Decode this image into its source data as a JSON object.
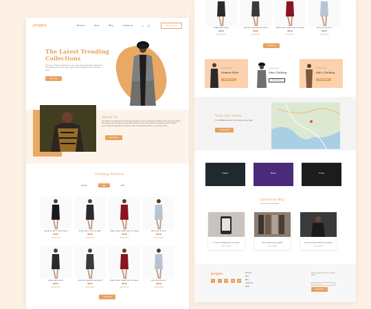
{
  "nav": {
    "logo": "Jerpjes",
    "links": [
      "About us",
      "Store",
      "Blog",
      "Contact us"
    ],
    "cta": "Sign up now"
  },
  "hero": {
    "title": "The Latest  Trending Collections",
    "body": "Check out our latest collection from our newly released assembly, featuring the best outfits you'll ever find. Sport a great look by wearing our new collection today.",
    "button": "Shop now"
  },
  "about": {
    "title": "About Us",
    "body": "Your fashion, the dream of our clothing and accessories. We're dedicated to providing you the very best products. Our company was founded in the year 2020 by fashion lovers with a passion for designing clothes. Whether you're looking for inspiration for the latest trends, or stunning accessories, we are here to help.",
    "button": "Read more"
  },
  "featured": {
    "title": "Trending Products",
    "tabs": [
      {
        "label": "Women",
        "active": false
      },
      {
        "label": "Men",
        "active": true
      },
      {
        "label": "Kids",
        "active": false
      }
    ],
    "row1": [
      {
        "name": "ONE NECK PRETTY NICE DRESS",
        "price": "$19.99",
        "stars": "★★★★★",
        "color": "#1a1a1a"
      },
      {
        "name": "BOXER ONE LONG LOW SHIRT",
        "price": "$29.99",
        "stars": "★★★★★",
        "color": "#2b2b2b"
      },
      {
        "name": "WRAP VELVET WRAPOVER VOL DRESS",
        "price": "$24.99",
        "stars": "★★★★★",
        "color": "#8b1420"
      },
      {
        "name": "LAYTON SLOUCH FIT",
        "price": "$22.99",
        "stars": "★★★★★",
        "color": "#b8c4d4"
      }
    ],
    "row2": [
      {
        "name": "DENIM SHIRT DRESS",
        "price": "$18.99",
        "stars": "★★★★★",
        "color": "#2a2a2a"
      },
      {
        "name": "ONE SHOULDER MINI SEQUENCE",
        "price": "$25.99",
        "stars": "★★★★★",
        "color": "#3a3a3a"
      },
      {
        "name": "WRAP VELVET WRAPOVER VOL DRESS",
        "price": "$24.99",
        "stars": "★★★★★",
        "color": "#8b1420"
      },
      {
        "name": "LAYTON SLOUCH FIT",
        "price": "$22.99",
        "stars": "★★★★★",
        "color": "#b8c4d4"
      }
    ],
    "load_more": "Load More"
  },
  "right_products": [
    {
      "name": "DENIM SHIRT DRESS",
      "price": "$18.99",
      "stars": "★★★★★",
      "color": "#2a2a2a"
    },
    {
      "name": "ONE SHOULDER MINI SEQUENCE",
      "price": "$25.99",
      "stars": "★★★★★",
      "color": "#3a3a3a"
    },
    {
      "name": "WRAP VELVET WRAPOVER VOL DRESS",
      "price": "$24.99",
      "stars": "★★★★★",
      "color": "#8b1420"
    },
    {
      "name": "LAYTON SLOUCH FIT",
      "price": "$22.99",
      "stars": "★★★★★",
      "color": "#b8c4d4"
    }
  ],
  "right_load_more": "Load More",
  "categories": [
    {
      "label": "UP TO 50% OFF",
      "name": "Women Shirt",
      "button": "Discover more"
    },
    {
      "label": "UP TO 50% OFF",
      "name": "Men Clothing",
      "button": "Discover more"
    },
    {
      "label": "UP TO 40% OFF",
      "name": "Kid's Clothing",
      "button": "Discover more"
    }
  ],
  "store": {
    "title": "Visit Our Store:",
    "address": "No. 45 Williams Avenue, Grove Estate, Lekki, Lagos",
    "button": "Get Direction"
  },
  "videos": [
    {
      "label": "Fashion"
    },
    {
      "label": "Beauty"
    },
    {
      "label": "Trendy"
    }
  ],
  "blog": {
    "title": "Latest from Blog",
    "subtitle": "Check out our trending topics",
    "posts": [
      {
        "title": "37 Tips for shopping online at a bargain",
        "date": "Dec. 10,2020"
      },
      {
        "title": "How to organize your wardrobe",
        "date": "Dec. 10,2020"
      },
      {
        "title": "Fashion trends from 2020 that are popular",
        "date": "Dec. 10,2020"
      }
    ]
  },
  "footer": {
    "logo": "Jerpjes",
    "social": [
      "f",
      "t",
      "in",
      "ig",
      "yt"
    ],
    "links": [
      "About us",
      "Store",
      "Blog",
      "Contact Us",
      "FAQS"
    ],
    "subscribe_text": "Enter your mail to receive our latest offers",
    "input_placeholder": "Enter your Email",
    "button": "Subscribe"
  },
  "colors": {
    "accent": "#e6a35d",
    "peach": "#fbd2ad",
    "bg": "#fdf1e6"
  }
}
